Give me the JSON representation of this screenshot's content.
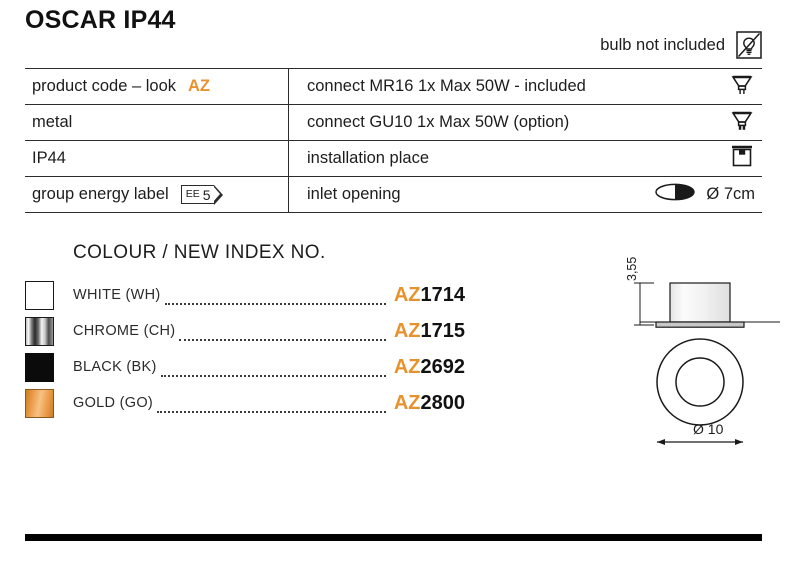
{
  "title": "OSCAR IP44",
  "bulb_note": {
    "text": "bulb not included",
    "icon": "bulb-crossed-icon"
  },
  "spec_table": {
    "rows": [
      {
        "left_label": "product code – look",
        "left_accent": "AZ",
        "right_label": "connect MR16 1x Max 50W - included",
        "right_icon": "mr16-lamp-icon",
        "right_value": ""
      },
      {
        "left_label": "metal",
        "left_accent": "",
        "right_label": "connect GU10 1x Max 50W (option)",
        "right_icon": "gu10-lamp-icon",
        "right_value": ""
      },
      {
        "left_label": "IP44",
        "left_accent": "",
        "right_label": "installation place",
        "right_icon": "ceiling-mount-icon",
        "right_value": ""
      },
      {
        "left_label": "group energy label",
        "left_accent": "",
        "left_badge": {
          "prefix": "EE",
          "value": "5"
        },
        "right_label": "inlet opening",
        "right_icon": "inlet-opening-icon",
        "right_value": "Ø 7cm"
      }
    ]
  },
  "colour_section": {
    "heading": "COLOUR / NEW INDEX NO.",
    "items": [
      {
        "name": "WHITE (WH)",
        "swatch": "white",
        "code_prefix": "AZ",
        "code_number": "1714"
      },
      {
        "name": "CHROME (CH)",
        "swatch": "chrome",
        "code_prefix": "AZ",
        "code_number": "1715"
      },
      {
        "name": "BLACK (BK)",
        "swatch": "black",
        "code_prefix": "AZ",
        "code_number": "2692"
      },
      {
        "name": "GOLD (GO)",
        "swatch": "gold",
        "code_prefix": "AZ",
        "code_number": "2800"
      }
    ]
  },
  "technical_drawing": {
    "height_dimension": "3,55",
    "width_dimension": "Ø 10",
    "side_view": "recessed-downlight-side-view",
    "top_view": "recessed-downlight-top-view"
  },
  "colors": {
    "accent": "#e8922e",
    "text": "#1d1d1d",
    "rule": "#2b2b2b",
    "bar": "#000000"
  }
}
